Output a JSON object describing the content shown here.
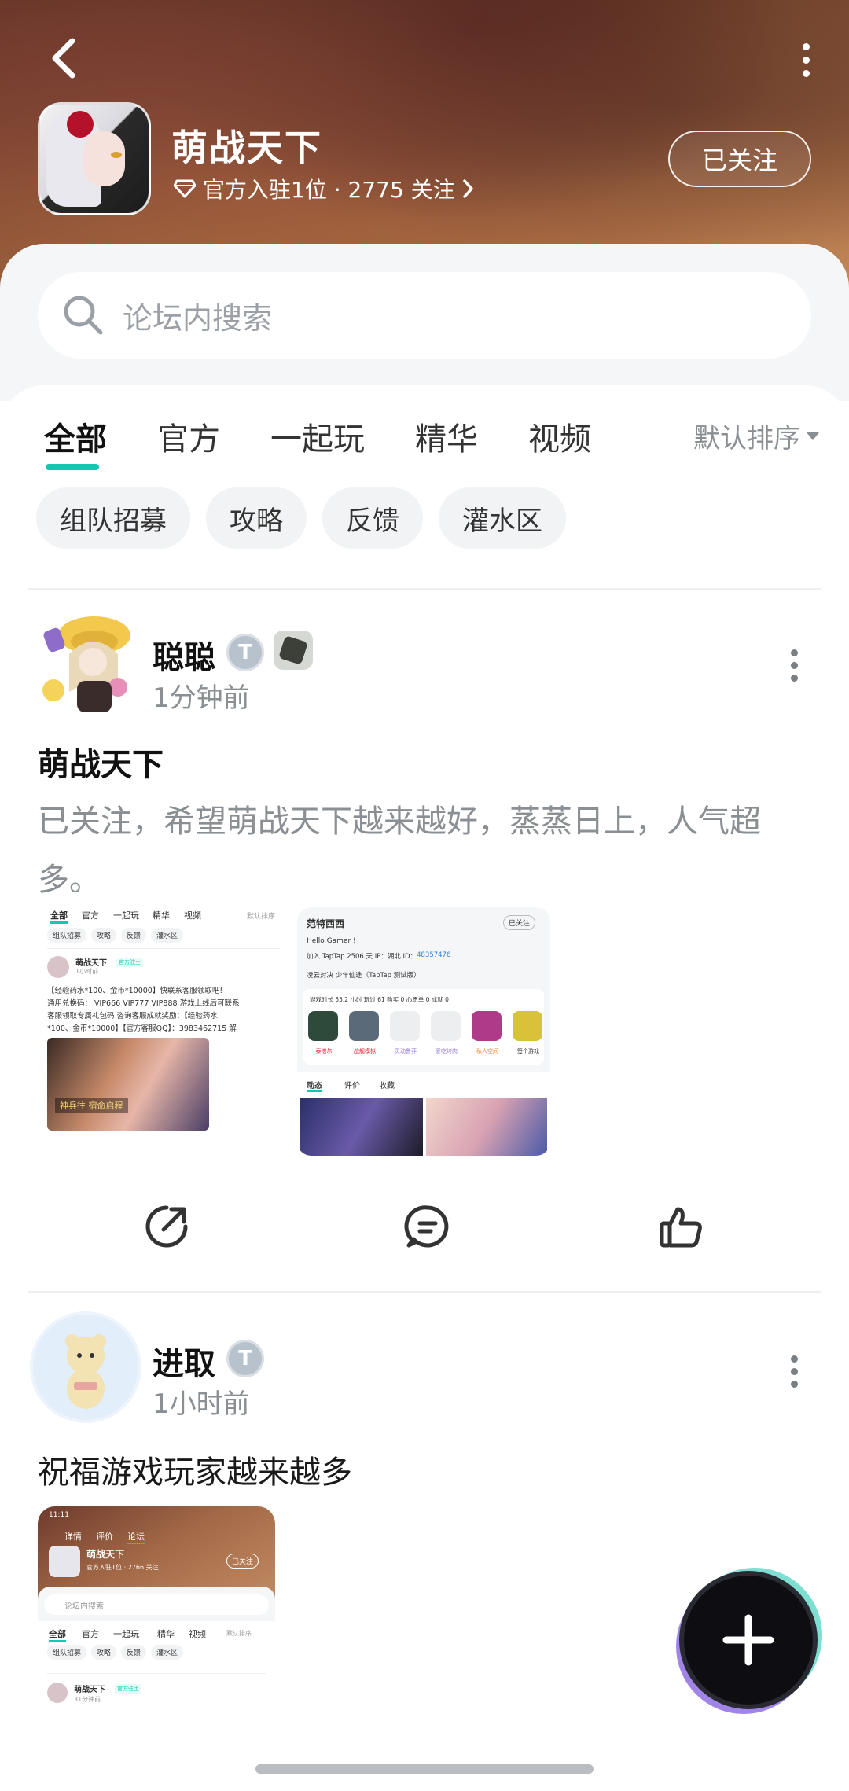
{
  "header": {
    "title": "萌战天下",
    "meta": "官方入驻1位 · 2775 关注",
    "follow_label": "已关注",
    "back_icon": "back-arrow-icon",
    "more_icon": "more-vertical-icon"
  },
  "search": {
    "placeholder": "论坛内搜索"
  },
  "tabs": [
    {
      "label": "全部",
      "active": true
    },
    {
      "label": "官方"
    },
    {
      "label": "一起玩"
    },
    {
      "label": "精华"
    },
    {
      "label": "视频"
    }
  ],
  "sort_label": "默认排序",
  "chips": [
    "组队招募",
    "攻略",
    "反馈",
    "灌水区"
  ],
  "posts": [
    {
      "author": "聪聪",
      "time": "1分钟前",
      "title": "萌战天下",
      "body": "已关注，希望萌战天下越来越好，蒸蒸日上，人气超多。",
      "thumb1": {
        "tabs": [
          "全部",
          "官方",
          "一起玩",
          "精华",
          "视频"
        ],
        "sort": "默认排序",
        "chips": [
          "组队招募",
          "攻略",
          "反馈",
          "灌水区"
        ],
        "author": "萌战天下",
        "badge": "官方驻土",
        "time": "1小时前",
        "line1": "【经验药水*100、金币*10000】快联系客服领取吧!",
        "line2": "通用兑换码： VIP666 VIP777 VIP888 游戏上线后可联系",
        "line3": "客服领取专属礼包码 咨询客服成就奖励：【经验药水",
        "line4": "*100、金币*10000】【官方客服QQ】：3983462715 解",
        "banner_text": "神兵往 宿命启程"
      },
      "thumb2": {
        "name": "范特西西",
        "follow": "已关注",
        "greeting": "Hello Gamer !",
        "info_prefix": "加入 TapTap 2506 天  IP：湖北  ID：",
        "info_id": "48357476",
        "games_line": "凌云对决    少年仙途（TapTap 测试版）",
        "stats": "游戏时长 55.2 小时  玩过 61  购买 0  心愿单 0  成就 0",
        "icons": [
          "泰塔尔",
          "战舰模拟",
          "灵动鲁莽",
          "爱吃烤肉",
          "私人空间",
          "签个游戏"
        ],
        "tabs": [
          "动态",
          "评价",
          "收藏"
        ]
      }
    },
    {
      "author": "进取",
      "time": "1小时前",
      "title": "祝福游戏玩家越来越多",
      "thumb": {
        "time": "11:11",
        "tabs_top": [
          "详情",
          "评价",
          "论坛"
        ],
        "title": "萌战天下",
        "meta": "官方入驻1位 · 2766 关注",
        "follow": "已关注",
        "search": "论坛内搜索",
        "tabs": [
          "全部",
          "官方",
          "一起玩",
          "精华",
          "视频"
        ],
        "sort": "默认排序",
        "chips": [
          "组队招募",
          "攻略",
          "反馈",
          "灌水区"
        ],
        "author": "萌战天下",
        "badge": "官方驻土",
        "time_post": "31分钟前"
      }
    }
  ],
  "colors": {
    "accent": "#14c7b0",
    "muted": "#8a8f94",
    "chip_bg": "#f1f3f4"
  },
  "icons": [
    "search-icon",
    "share-icon",
    "comment-icon",
    "like-icon",
    "plus-icon",
    "diamond-icon",
    "chevron-right-icon"
  ]
}
